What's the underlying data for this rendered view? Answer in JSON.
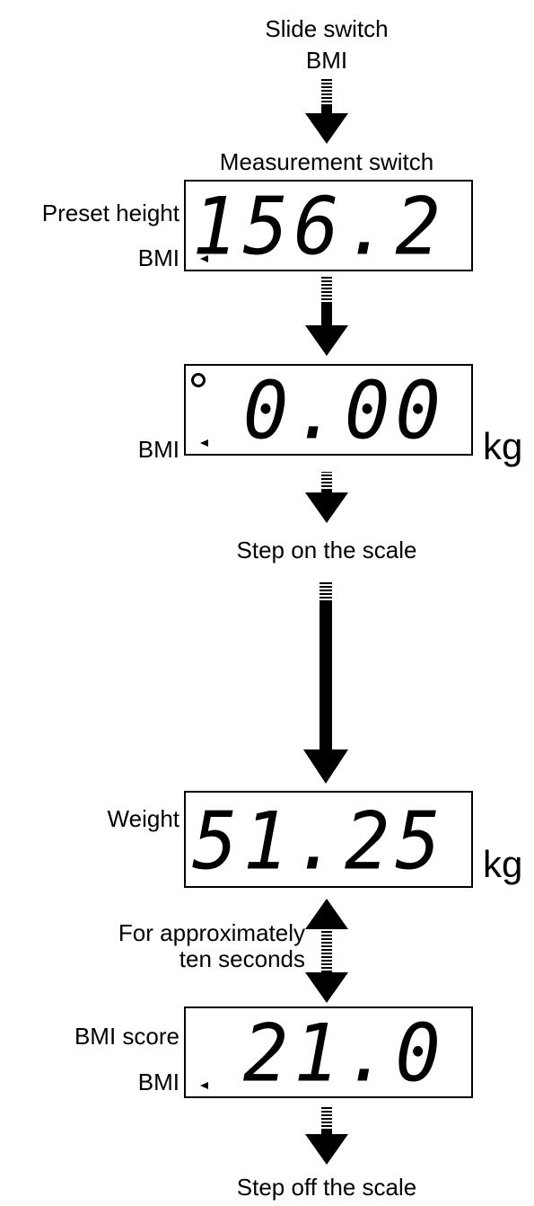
{
  "flow": {
    "slide_switch": "Slide switch",
    "slide_switch_mode": "BMI",
    "measurement_switch": "Measurement switch",
    "step_on": "Step on the scale",
    "duration_line1": "For approximately",
    "duration_line2": "ten seconds",
    "step_off": "Step off the scale"
  },
  "displays": {
    "preset": {
      "label": "Preset height",
      "mode": "BMI",
      "value": "156.2"
    },
    "zero": {
      "mode": "BMI",
      "value": "0.00",
      "unit": "kg",
      "indicator": "circle-icon"
    },
    "weight": {
      "label": "Weight",
      "value": "51.25",
      "unit": "kg"
    },
    "bmi": {
      "label": "BMI score",
      "mode": "BMI",
      "value": "21.0"
    }
  }
}
